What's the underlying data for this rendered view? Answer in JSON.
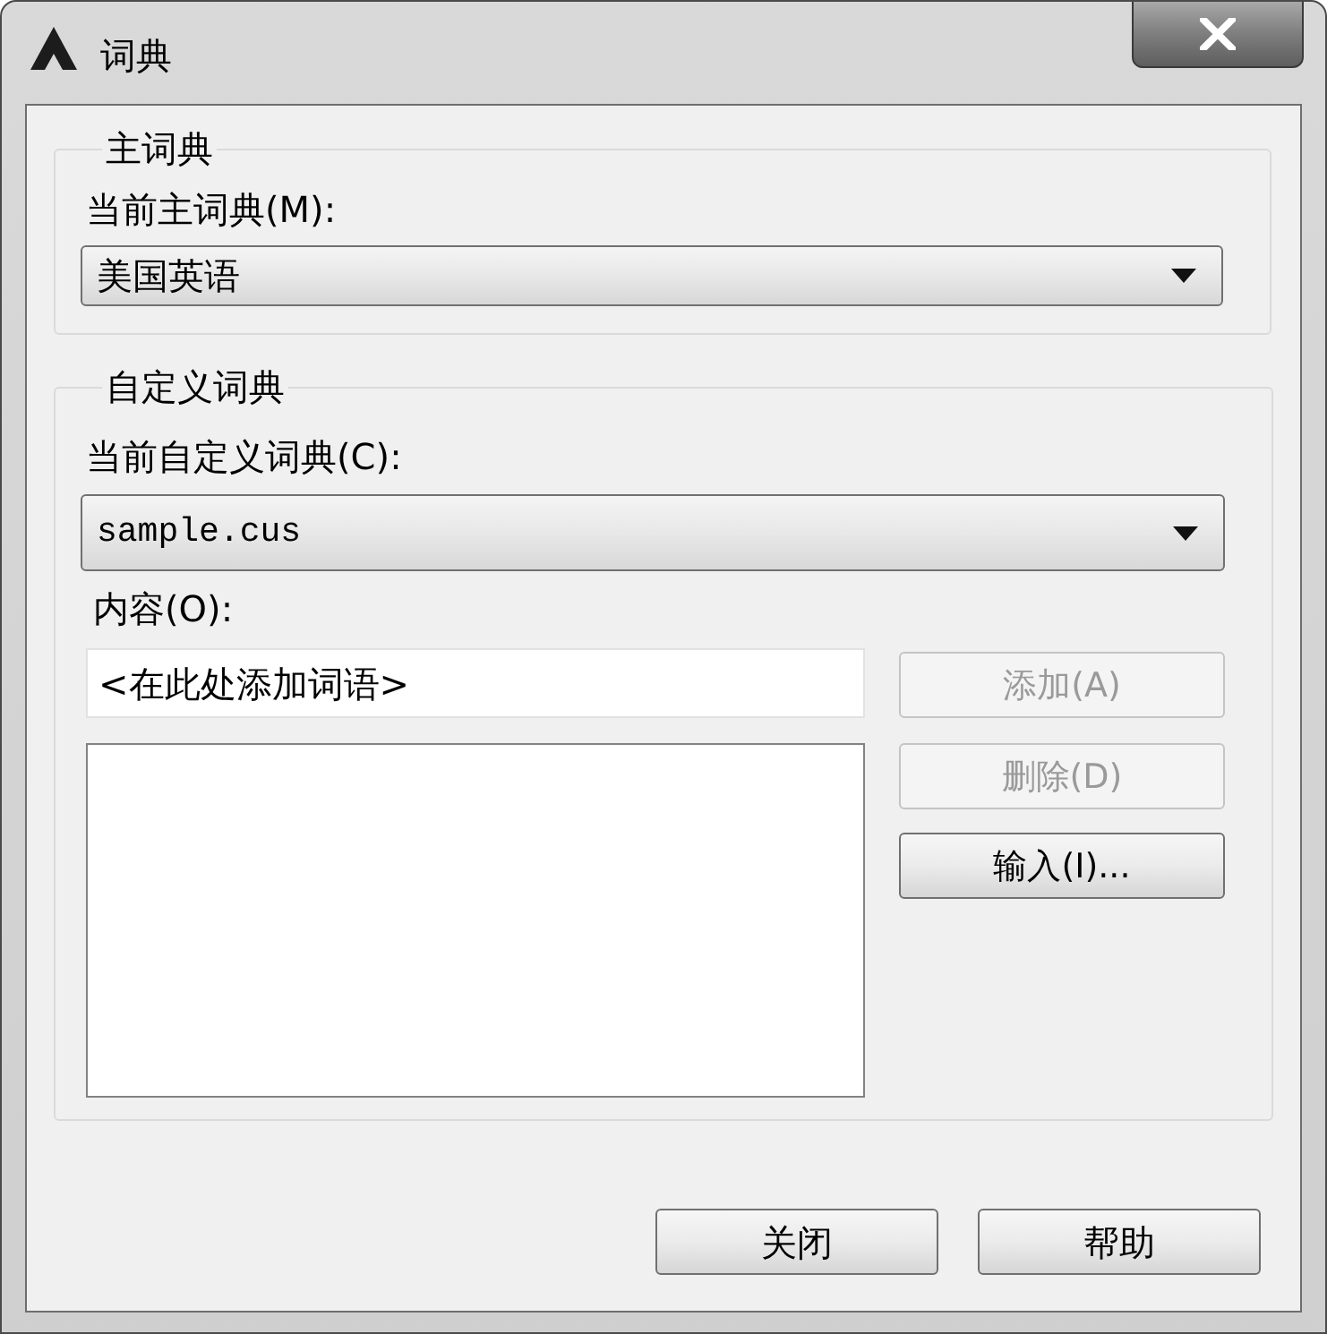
{
  "window": {
    "title": "词典"
  },
  "main_dictionary": {
    "title": "主词典",
    "label": "当前主词典(M):",
    "dropdown": {
      "value": "美国英语"
    }
  },
  "custom_dictionary": {
    "title": "自定义词典",
    "label": "当前自定义词典(C):",
    "dropdown": {
      "value": "sample.cus"
    },
    "content_label": "内容(O):",
    "word_input": {
      "placeholder": "<在此处添加词语>"
    },
    "buttons": [
      {
        "label": "添加(A)",
        "disabled": true
      },
      {
        "label": "删除(D)",
        "disabled": true
      },
      {
        "label": "输入(I)...",
        "disabled": false
      }
    ]
  },
  "footer_buttons": [
    {
      "label": "关闭"
    },
    {
      "label": "帮助"
    }
  ]
}
